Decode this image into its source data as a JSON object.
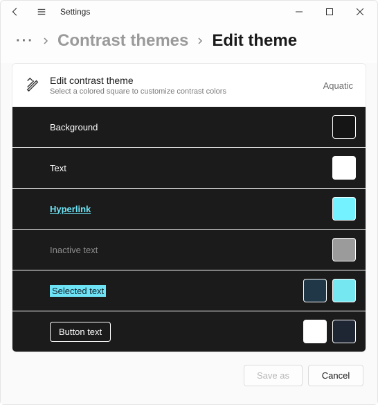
{
  "titlebar": {
    "title": "Settings"
  },
  "breadcrumb": {
    "parent": "Contrast themes",
    "current": "Edit theme"
  },
  "header": {
    "title": "Edit contrast theme",
    "subtitle": "Select a colored square to customize contrast colors",
    "theme_name": "Aquatic"
  },
  "rows": [
    {
      "label": "Background",
      "swatches": [
        "#151515"
      ]
    },
    {
      "label": "Text",
      "swatches": [
        "#ffffff"
      ]
    },
    {
      "label": "Hyperlink",
      "swatches": [
        "#74f2ff"
      ]
    },
    {
      "label": "Inactive text",
      "swatches": [
        "#9b9b9b"
      ]
    },
    {
      "label": "Selected text",
      "swatches": [
        "#203747",
        "#74e7f0"
      ]
    },
    {
      "label": "Button text",
      "swatches": [
        "#ffffff",
        "#1f2633"
      ]
    }
  ],
  "footer": {
    "save_as": "Save as",
    "cancel": "Cancel"
  }
}
